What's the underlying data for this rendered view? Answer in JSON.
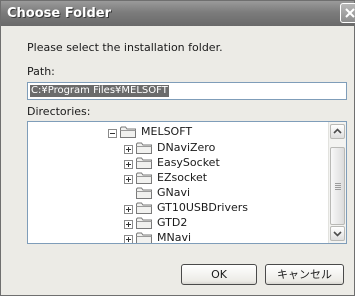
{
  "window": {
    "title": "Choose Folder"
  },
  "dialog": {
    "instruction": "Please select the installation folder.",
    "path_label": "Path:",
    "path_value": "C:¥Program Files¥MELSOFT",
    "directories_label": "Directories:"
  },
  "tree": {
    "root": {
      "label": "MELSOFT",
      "expanded": true
    },
    "children": [
      {
        "label": "DNaviZero",
        "expander": "plus"
      },
      {
        "label": "EasySocket",
        "expander": "plus"
      },
      {
        "label": "EZsocket",
        "expander": "plus"
      },
      {
        "label": "GNavi",
        "expander": "none"
      },
      {
        "label": "GT10USBDrivers",
        "expander": "plus"
      },
      {
        "label": "GTD2",
        "expander": "plus"
      },
      {
        "label": "MNavi",
        "expander": "plus"
      }
    ]
  },
  "buttons": {
    "ok": "OK",
    "cancel": "キャンセル"
  }
}
